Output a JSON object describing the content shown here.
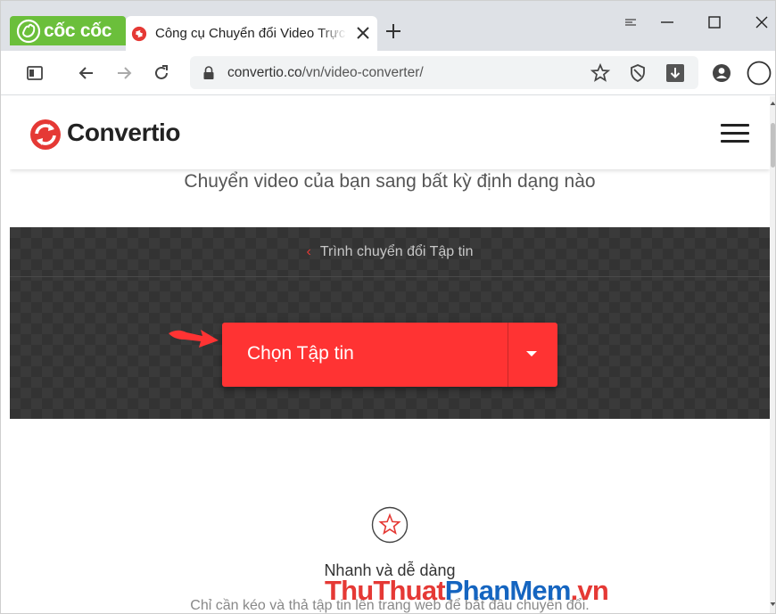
{
  "browser": {
    "brand_name": "cốc cốc",
    "tab_title": "Công cụ Chuyển đổi Video Trực tuyến",
    "url_host": "convertio.co",
    "url_path": "/vn/video-converter/",
    "colors": {
      "brand_green": "#6bbf3b",
      "accent_red": "#ff3333"
    }
  },
  "site": {
    "name": "Convertio",
    "subtitle": "Chuyển video của bạn sang bất kỳ định dạng nào",
    "breadcrumb": "Trình chuyển đổi Tập tin",
    "choose_file_label": "Chọn Tập tin",
    "feature_title": "Nhanh và dễ dàng",
    "feature_desc": "Chỉ cần kéo và thả tập tin lên trang web để bắt đầu chuyển đổi."
  },
  "watermark": {
    "part1": "ThuThuat",
    "part2": "PhanMem",
    "part3": ".vn"
  },
  "icons": [
    "coccoc-logo-icon",
    "convertio-favicon-icon",
    "close-icon",
    "plus-icon",
    "window-controls-icons",
    "sidebar-icon",
    "back-icon",
    "forward-icon",
    "reload-icon",
    "lock-icon",
    "star-icon",
    "shield-icon",
    "download-icon",
    "profile-icon",
    "menu-circle-icon",
    "convertio-logo-icon",
    "hamburger-icon",
    "chevron-left-icon",
    "caret-down-icon",
    "pointer-arrow-icon",
    "star-circle-icon"
  ]
}
